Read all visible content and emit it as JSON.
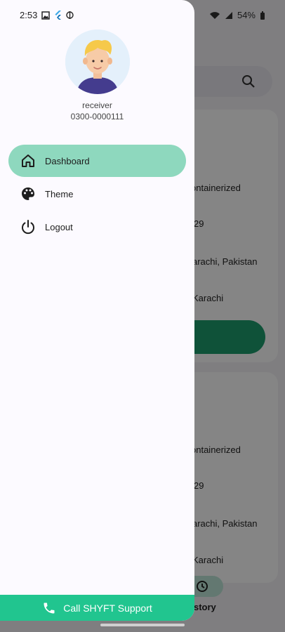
{
  "status_bar": {
    "time": "2:53",
    "battery": "54%"
  },
  "background": {
    "card1": {
      "line1": "ontainerized",
      "line2": "29",
      "line3": "arachi, Pakistan",
      "line4": "Karachi"
    },
    "card2": {
      "line1": "ontainerized",
      "line2": "29",
      "line3": "arachi, Pakistan",
      "line4": "Karachi"
    },
    "nav_label": "story"
  },
  "drawer": {
    "user": {
      "name": "receiver",
      "phone": "0300-0000111"
    },
    "menu": [
      {
        "label": "Dashboard",
        "icon": "home-icon",
        "active": true
      },
      {
        "label": "Theme",
        "icon": "palette-icon",
        "active": false
      },
      {
        "label": "Logout",
        "icon": "power-icon",
        "active": false
      }
    ],
    "support_label": "Call SHYFT Support"
  },
  "colors": {
    "accent": "#21c58f",
    "active_item": "#8ed8be",
    "drawer_bg": "#fcfaff"
  }
}
